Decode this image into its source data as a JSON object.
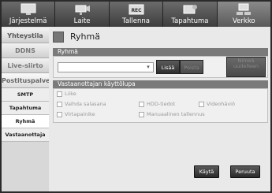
{
  "nav": {
    "tabs": [
      {
        "label": "Järjestelmä",
        "icon": "monitor-icon"
      },
      {
        "label": "Laite",
        "icon": "camera-icon"
      },
      {
        "label": "Tallenna",
        "icon": "rec-icon"
      },
      {
        "label": "Tapahtuma",
        "icon": "event-icon"
      },
      {
        "label": "Verkko",
        "icon": "network-icon"
      }
    ]
  },
  "sidebar": {
    "items": [
      "Yhteystila",
      "DDNS",
      "Live-siirto",
      "Postituspalvelu"
    ],
    "subitems": [
      "SMTP",
      "Tapahtuma",
      "Ryhmä",
      "Vastaanottaja"
    ]
  },
  "page": {
    "title": "Ryhmä"
  },
  "group_panel": {
    "header": "Ryhmä",
    "select_value": "",
    "add_label": "Lisää",
    "delete_label": "Poista",
    "rename_label": "Nimeä uudelleen"
  },
  "perm_panel": {
    "header": "Vastaanottajan käyttölupa",
    "options": [
      "Liike",
      "Vaihda salasana",
      "HDD-tiedot",
      "Videohäviö",
      "Virtapainike",
      "Manuaalinen tallennus"
    ]
  },
  "footer": {
    "apply_label": "Käytä",
    "cancel_label": "Peruuta"
  }
}
